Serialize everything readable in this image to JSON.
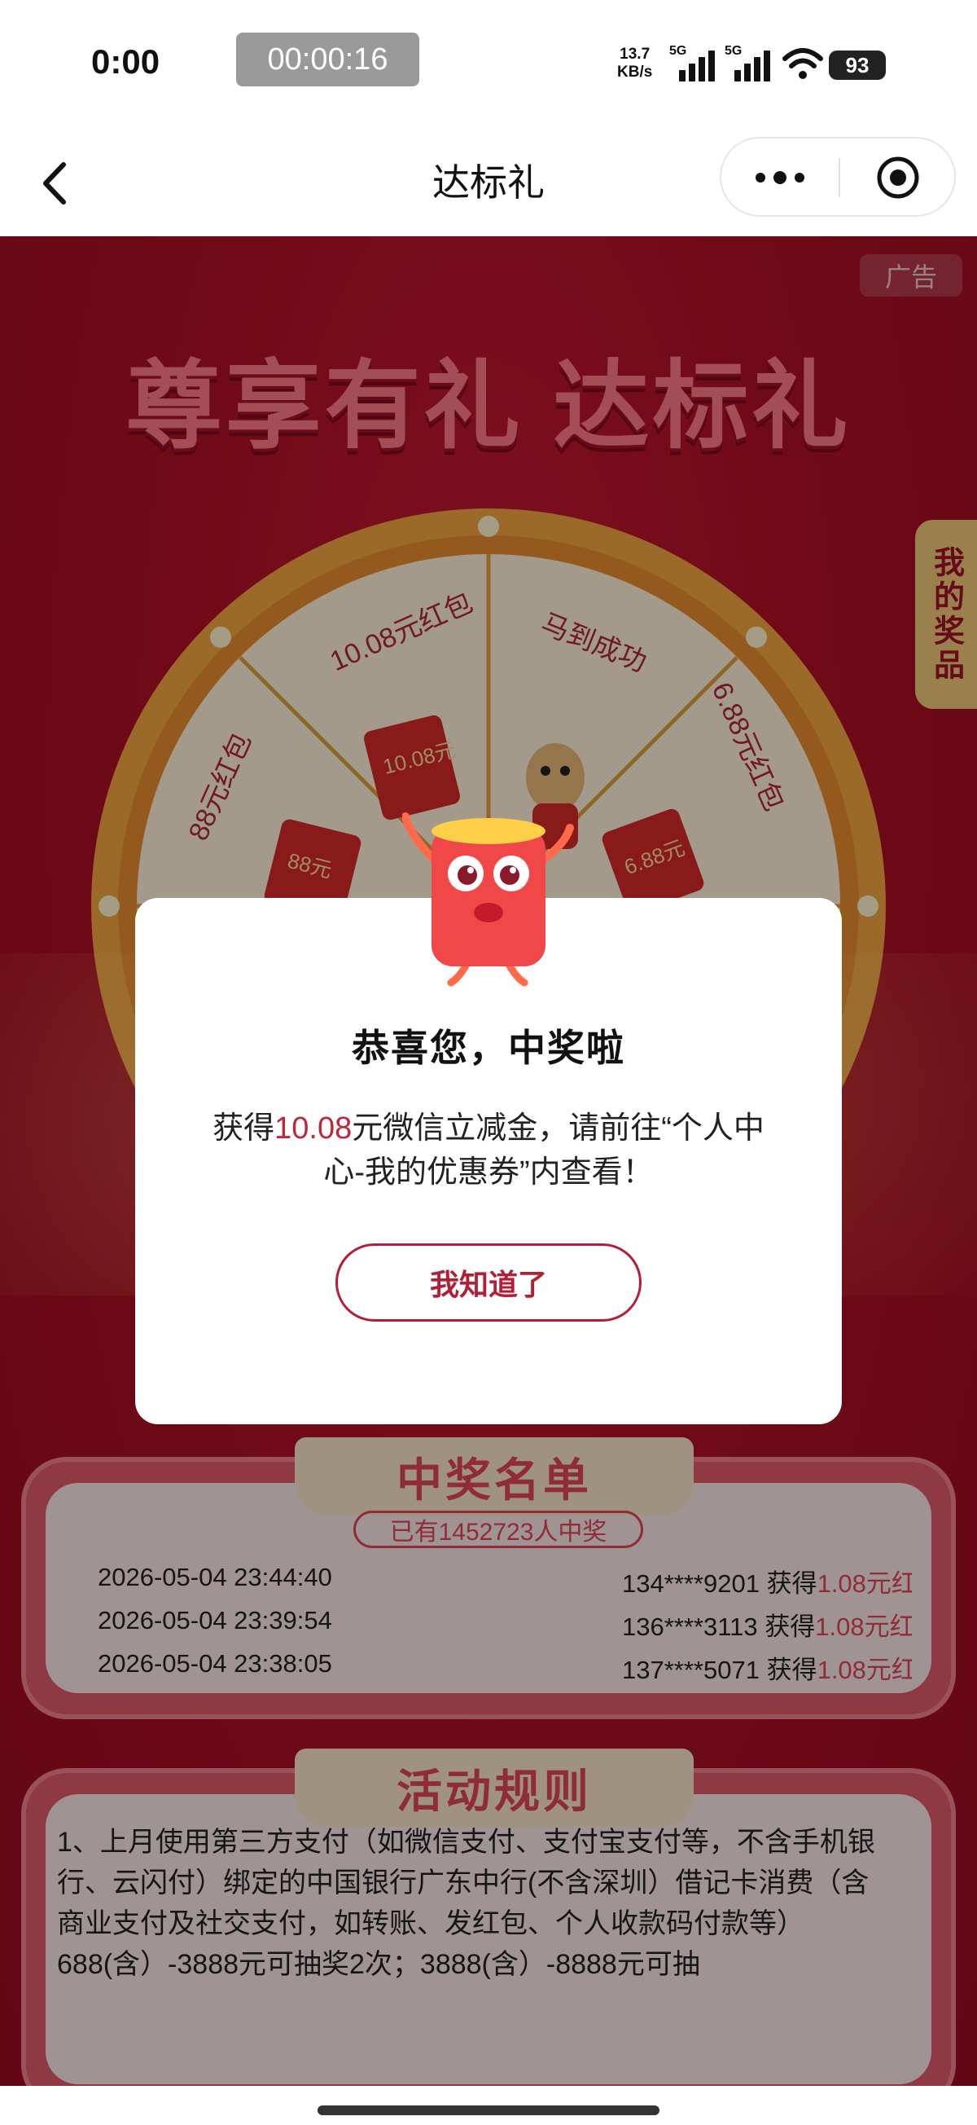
{
  "status_bar": {
    "time": "0:00",
    "recording_timer": "00:00:16",
    "net_speed_value": "13.7",
    "net_speed_unit": "KB/s",
    "signal_1_label": "5G",
    "signal_2_label": "5G",
    "battery": "93"
  },
  "nav": {
    "title": "达标礼"
  },
  "banner": {
    "ad_tag": "广告",
    "title": "尊享有礼 达标礼",
    "side_tab": "我的奖品"
  },
  "wheel": {
    "segments": [
      "88元红包",
      "10.08元红包",
      "马到成功",
      "6.88元红包"
    ],
    "card_labels": [
      "88元",
      "10.08元",
      "6.88元"
    ]
  },
  "modal": {
    "title": "恭喜您，中奖啦",
    "message_prefix": "获得",
    "message_amount": "10.08",
    "message_suffix": "元微信立减金，请前往“个人中心-我的优惠券”内查看！",
    "button_label": "我知道了"
  },
  "winners": {
    "title": "中奖名单",
    "count_label": "已有1452723人中奖",
    "rows": [
      {
        "time": "2026-05-04 23:44:40",
        "phone": "134****9201",
        "action": "获得",
        "prize": "1.08元红"
      },
      {
        "time": "2026-05-04 23:39:54",
        "phone": "136****3113",
        "action": "获得",
        "prize": "1.08元红"
      },
      {
        "time": "2026-05-04 23:38:05",
        "phone": "137****5071",
        "action": "获得",
        "prize": "1.08元红"
      }
    ]
  },
  "rules": {
    "title": "活动规则",
    "text": "1、上月使用第三方支付（如微信支付、支付宝支付等，不含手机银行、云闪付）绑定的中国银行广东中行(不含深圳）借记卡消费（含商业支付及社交支付，如转账、发红包、个人收款码付款等）688(含）-3888元可抽奖2次；3888(含）-8888元可抽"
  },
  "colors": {
    "accent_red": "#b41e35",
    "amount_red": "#c0263b",
    "banner_bg": "#b01026",
    "gold": "#f0c878"
  }
}
